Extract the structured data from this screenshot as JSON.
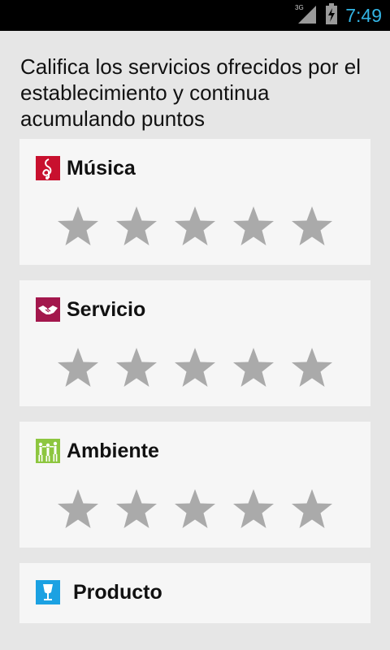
{
  "status_bar": {
    "network": "3G",
    "time": "7:49",
    "time_color": "#33b5e5"
  },
  "intro_text": "Califica los servicios ofrecidos por el establecimiento y continua acumulando puntos",
  "categories": [
    {
      "label": "Música",
      "icon": "music-note-icon",
      "icon_color": "#c8102e",
      "rating": 0,
      "max": 5
    },
    {
      "label": "Servicio",
      "icon": "handshake-icon",
      "icon_color": "#a3174c",
      "rating": 0,
      "max": 5
    },
    {
      "label": "Ambiente",
      "icon": "people-dancing-icon",
      "icon_color": "#8dc63f",
      "rating": 0,
      "max": 5
    },
    {
      "label": "Producto",
      "icon": "glass-icon",
      "icon_color": "#1ba1e2"
    }
  ],
  "colors": {
    "background": "#e6e6e6",
    "card": "#f6f6f6",
    "star_empty": "#aaaaaa"
  }
}
